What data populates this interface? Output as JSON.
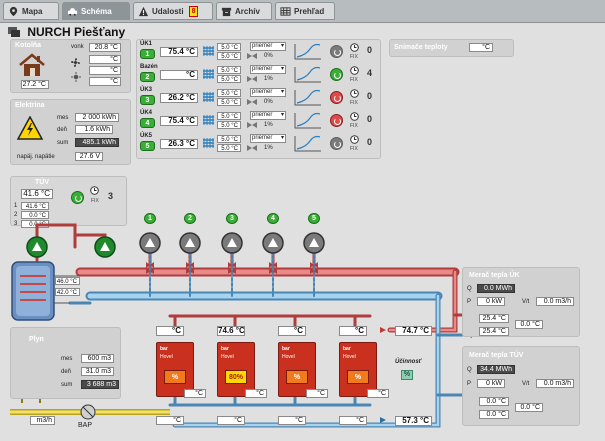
{
  "tabs": [
    {
      "label": "Mapa",
      "icon": "map-pin-icon"
    },
    {
      "label": "Schéma",
      "icon": "car-icon"
    },
    {
      "label": "Udalosti",
      "icon": "warning-icon",
      "badge": "8"
    },
    {
      "label": "Archív",
      "icon": "archive-icon"
    },
    {
      "label": "Prehľad",
      "icon": "table-icon"
    }
  ],
  "header": {
    "title": "NURCH Piešťany"
  },
  "kotolna": {
    "title": "Kotolňa",
    "vonk_label": "vonk",
    "vonk": "20.8 °C",
    "t1": "27.2 °C",
    "f1": "°C",
    "f2": "°C",
    "f3": "°C"
  },
  "elektrina": {
    "title": "Elektrina",
    "mes_label": "mes",
    "mes": "2 000 kWh",
    "den_label": "deň",
    "den": "1.6 kWh",
    "sum_label": "sum",
    "sum": "485.1 kWh",
    "nap_label": "napäj. napätie",
    "nap": "27.6 V"
  },
  "circuits": [
    {
      "label": "ÚK1",
      "temp": "75.4 °C",
      "set_a": "5.0 °C",
      "set_b": "5.0 °C",
      "mode": "priemer",
      "pct": "0%",
      "num": "1",
      "count": "0",
      "state": "grey"
    },
    {
      "label": "Bazén",
      "temp": "°C",
      "set_a": "5.0 °C",
      "set_b": "5.0 °C",
      "mode": "priemer",
      "pct": "1%",
      "num": "2",
      "count": "4",
      "state": "green"
    },
    {
      "label": "ÚK3",
      "temp": "26.2 °C",
      "set_a": "5.0 °C",
      "set_b": "5.0 °C",
      "mode": "priemer",
      "pct": "0%",
      "num": "3",
      "count": "0",
      "state": "red"
    },
    {
      "label": "ÚK4",
      "temp": "75.4 °C",
      "set_a": "5.0 °C",
      "set_b": "5.0 °C",
      "mode": "priemer",
      "pct": "1%",
      "num": "4",
      "count": "0",
      "state": "red"
    },
    {
      "label": "ÚK5",
      "temp": "26.3 °C",
      "set_a": "5.0 °C",
      "set_b": "5.0 °C",
      "mode": "priemer",
      "pct": "1%",
      "num": "5",
      "count": "0",
      "state": "grey"
    }
  ],
  "fix_label": "FIX",
  "snimac": {
    "title": "Snímače teploty",
    "value": "°C"
  },
  "tuv": {
    "title": "TÚV",
    "main": "41.6 °C",
    "v1": "41.6 °C",
    "v2": "0.0 °C",
    "v3": "0.0 °C",
    "count": "3",
    "tank_top": "46.0 °C",
    "tank_bot": "42.0 °C"
  },
  "plyn": {
    "title": "Plyn",
    "mes_label": "mes",
    "mes": "600 m3",
    "den_label": "deň",
    "den": "31.0 m3",
    "sum_label": "sum",
    "sum": "3 688 m3",
    "meter": "m3/h",
    "bap": "BAP"
  },
  "boilers": [
    {
      "brand": "bar",
      "model": "Hovel",
      "pct": "%",
      "top": "°C",
      "out": "°C",
      "bot": "°C",
      "on": false
    },
    {
      "brand": "bar",
      "model": "Hovel",
      "pct": "80%",
      "top": "74.6 °C",
      "out": "°C",
      "bot": "°C",
      "on": true
    },
    {
      "brand": "bar",
      "model": "Hovel",
      "pct": "%",
      "top": "°C",
      "out": "°C",
      "bot": "°C",
      "on": false
    },
    {
      "brand": "bar",
      "model": "Hovel",
      "pct": "%",
      "top": "°C",
      "out": "°C",
      "bot": "°C",
      "on": false
    }
  ],
  "main_supply": "74.7 °C",
  "main_return": "57.3 °C",
  "ucinnost": {
    "label": "Účinnosť",
    "value": "%"
  },
  "merac_uk": {
    "title": "Merač tepla ÚK",
    "q_label": "Q",
    "q": "0.0 MWh",
    "p_label": "P",
    "p": "0 kW",
    "vh_label": "V/t",
    "vh": "0.0 m3/h",
    "t_in": "25.4 °C",
    "t_out": "25.4 °C",
    "dt": "0.0 °C"
  },
  "merac_tuv": {
    "title": "Merač tepla TÚV",
    "q_label": "Q",
    "q": "34.4 MWh",
    "p_label": "P",
    "p": "0 kW",
    "vh_label": "V/t",
    "vh": "0.0 m3/h",
    "t_in": "0.0 °C",
    "t_out": "0.0 °C",
    "dt": "0.0 °C"
  },
  "colors": {
    "pipe_hot": "#d9534f",
    "pipe_cold": "#6aaed6",
    "panel_title": "#ffffff",
    "accent_green": "#3bae37",
    "boiler_red": "#c9301d"
  }
}
